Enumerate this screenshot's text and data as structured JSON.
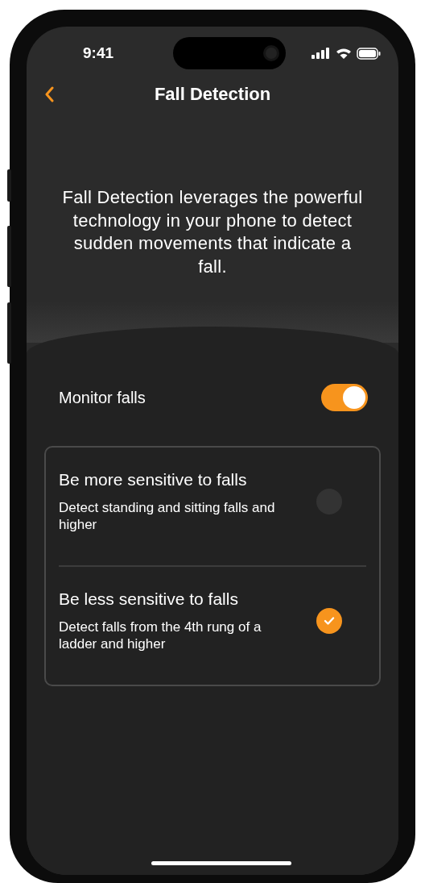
{
  "status_bar": {
    "time": "9:41"
  },
  "nav": {
    "title": "Fall Detection"
  },
  "description": "Fall Detection leverages the powerful technology in your phone to detect sudden movements that indicate a fall.",
  "monitor": {
    "label": "Monitor falls",
    "on": true
  },
  "options": [
    {
      "title": "Be more sensitive to falls",
      "description": "Detect standing and sitting falls and higher",
      "selected": false
    },
    {
      "title": "Be less sensitive to falls",
      "description": "Detect falls from the 4th rung of a ladder and higher",
      "selected": true
    }
  ]
}
